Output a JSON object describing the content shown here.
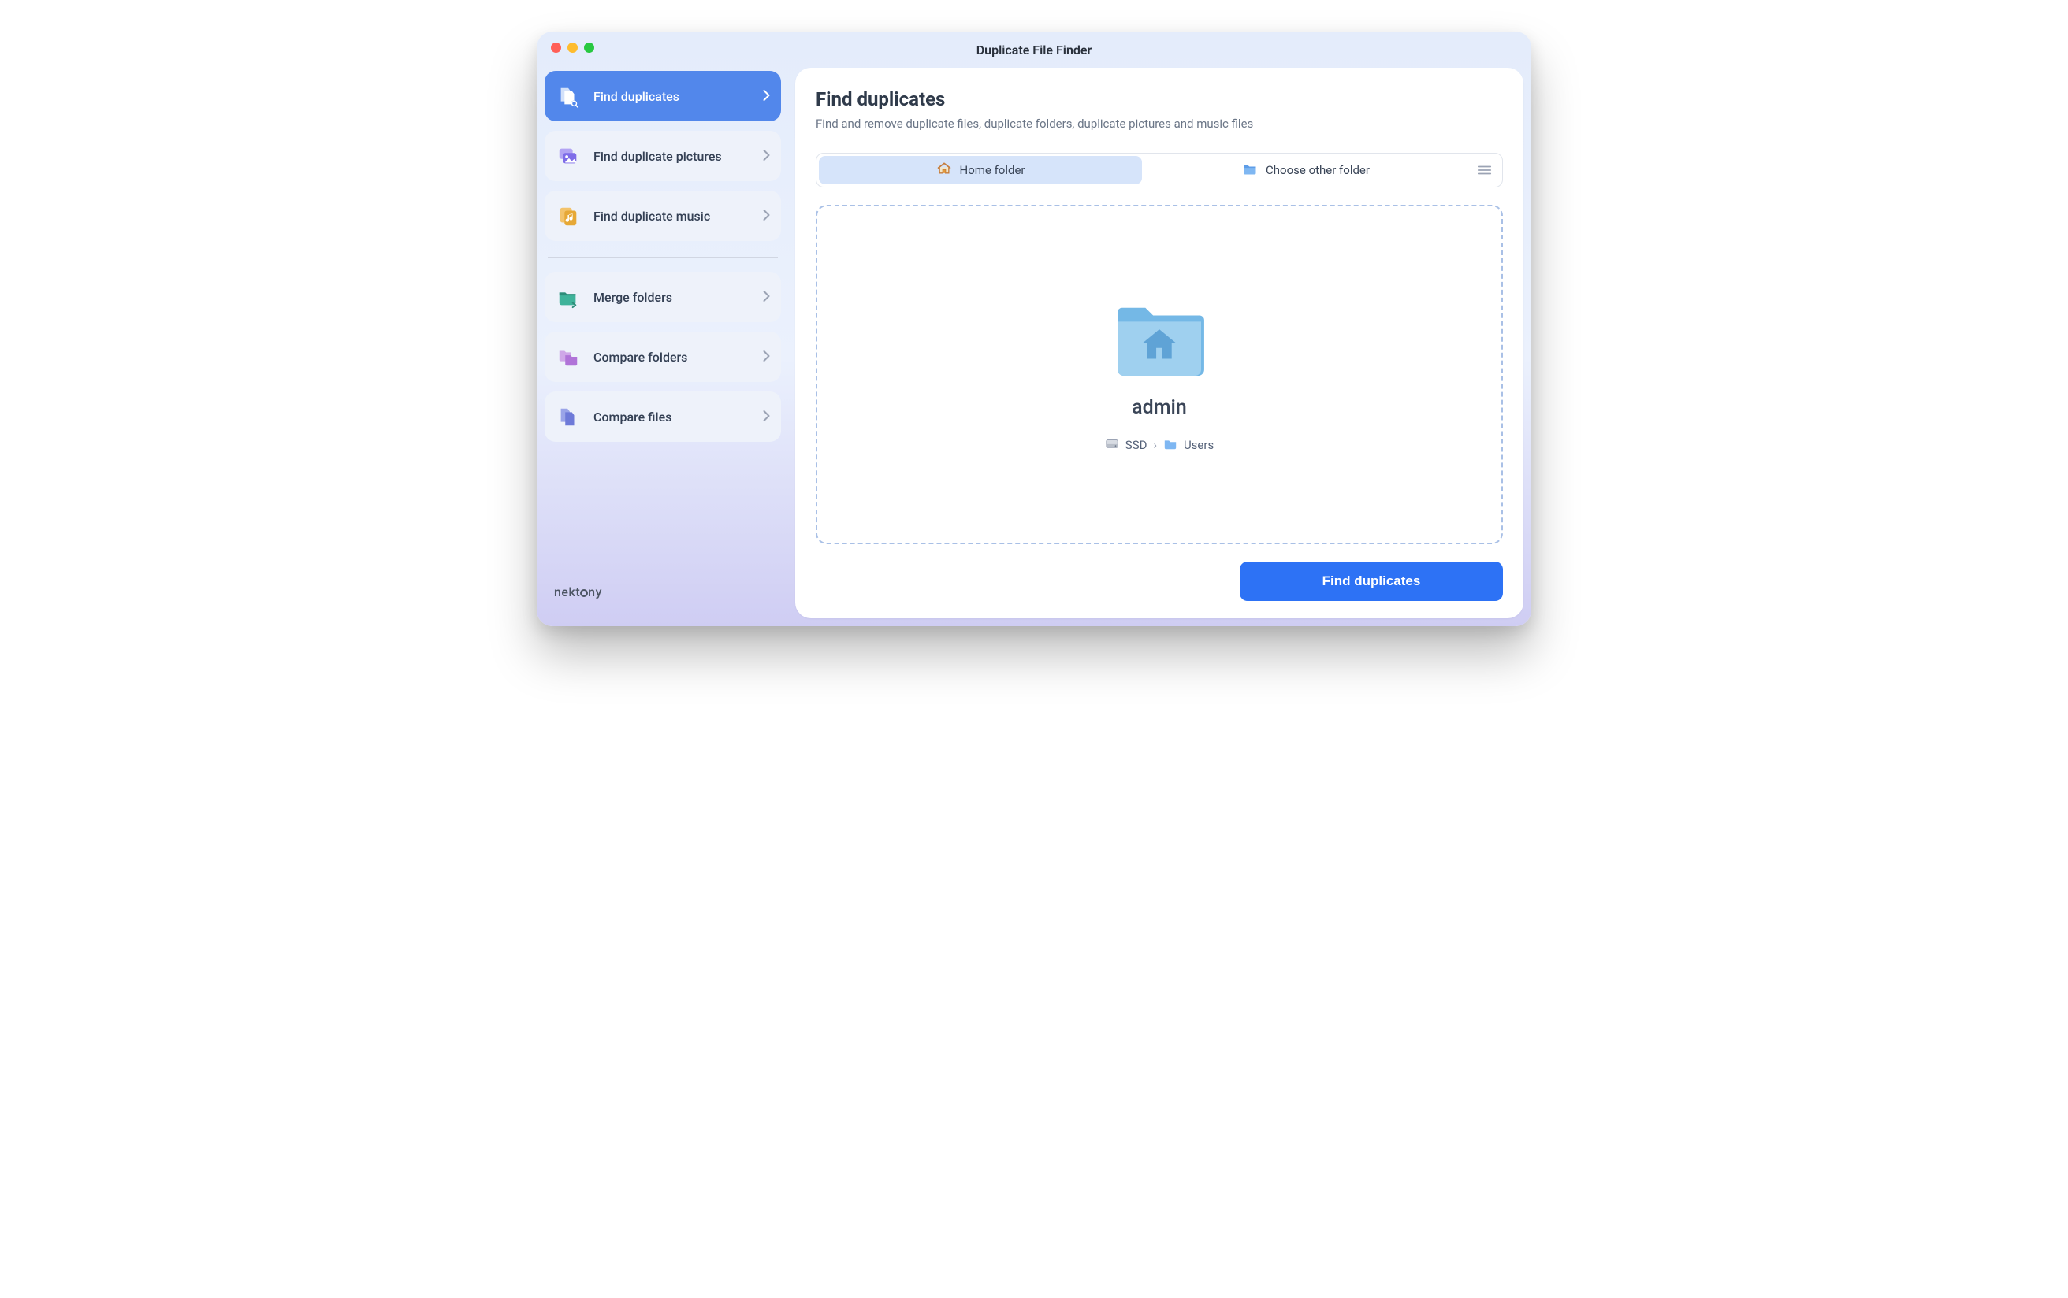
{
  "window": {
    "title": "Duplicate File Finder"
  },
  "brand": "nektony",
  "sidebar": {
    "group1": [
      {
        "label": "Find duplicates"
      },
      {
        "label": "Find duplicate pictures"
      },
      {
        "label": "Find duplicate music"
      }
    ],
    "group2": [
      {
        "label": "Merge folders"
      },
      {
        "label": "Compare folders"
      },
      {
        "label": "Compare files"
      }
    ]
  },
  "main": {
    "heading": "Find duplicates",
    "subheading": "Find and remove duplicate files, duplicate folders, duplicate pictures and music files",
    "segments": {
      "home": "Home folder",
      "other": "Choose other folder"
    },
    "dropzone": {
      "folder_name": "admin",
      "path": {
        "disk": "SSD",
        "parent": "Users"
      }
    },
    "primary_button": "Find duplicates"
  }
}
